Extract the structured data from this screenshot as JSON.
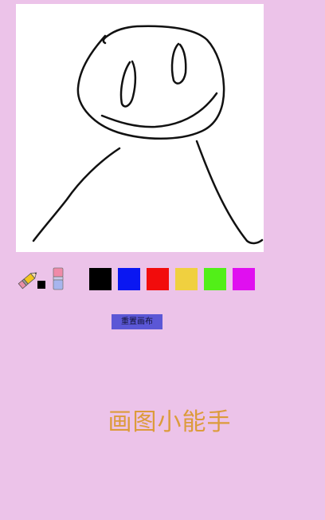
{
  "drawing_canvas": {
    "background": "#ffffff",
    "stroke_color": "#111111"
  },
  "toolbar": {
    "pencil_icon": "pencil-icon",
    "eraser_icon": "eraser-icon",
    "current_color": "#000000",
    "palette": [
      {
        "name": "black",
        "color": "#000000"
      },
      {
        "name": "blue",
        "color": "#0a17f2"
      },
      {
        "name": "red",
        "color": "#f20c0c"
      },
      {
        "name": "yellow",
        "color": "#f0d03f"
      },
      {
        "name": "green",
        "color": "#52ef18"
      },
      {
        "name": "magenta",
        "color": "#e00ff0"
      }
    ]
  },
  "reset_button": {
    "label": "重置画布"
  },
  "app_title": "画图小能手"
}
